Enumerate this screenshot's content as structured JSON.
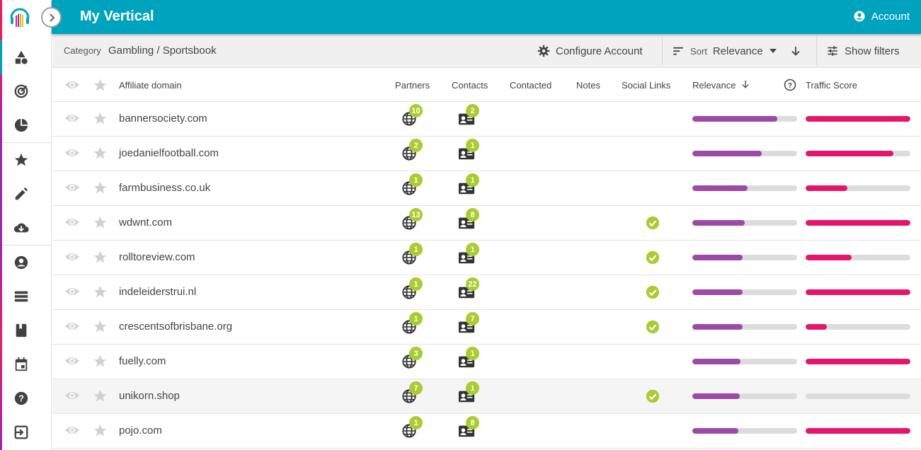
{
  "header": {
    "title": "My Vertical",
    "account_label": "Account"
  },
  "toolbar": {
    "category_label": "Category",
    "category_value": "Gambling / Sportsbook",
    "configure_label": "Configure Account",
    "sort_label": "Sort",
    "sort_value": "Relevance",
    "filters_label": "Show filters"
  },
  "table": {
    "headers": {
      "domain": "Affiliate domain",
      "partners": "Partners",
      "contacts": "Contacts",
      "contacted": "Contacted",
      "notes": "Notes",
      "social": "Social Links",
      "relevance": "Relevance",
      "traffic": "Traffic Score"
    },
    "rows": [
      {
        "domain": "bannersociety.com",
        "partners": "10",
        "contacts": "2",
        "social": false,
        "relevance": 0.81,
        "traffic": 1.0
      },
      {
        "domain": "joedanielfootball.com",
        "partners": "2",
        "contacts": "1",
        "social": false,
        "relevance": 0.66,
        "traffic": 0.84
      },
      {
        "domain": "farmbusiness.co.uk",
        "partners": "1",
        "contacts": "1",
        "social": false,
        "relevance": 0.53,
        "traffic": 0.4
      },
      {
        "domain": "wdwnt.com",
        "partners": "13",
        "contacts": "8",
        "social": true,
        "relevance": 0.5,
        "traffic": 1.0
      },
      {
        "domain": "rolltoreview.com",
        "partners": "1",
        "contacts": "1",
        "social": true,
        "relevance": 0.48,
        "traffic": 0.44
      },
      {
        "domain": "indeleiderstrui.nl",
        "partners": "1",
        "contacts": "22",
        "social": true,
        "relevance": 0.48,
        "traffic": 1.0
      },
      {
        "domain": "crescentsofbrisbane.org",
        "partners": "1",
        "contacts": "7",
        "social": true,
        "relevance": 0.48,
        "traffic": 0.2
      },
      {
        "domain": "fuelly.com",
        "partners": "3",
        "contacts": "1",
        "social": false,
        "relevance": 0.46,
        "traffic": 1.0
      },
      {
        "domain": "unikorn.shop",
        "partners": "7",
        "contacts": "1",
        "social": true,
        "relevance": 0.45,
        "traffic": 0.0
      },
      {
        "domain": "pojo.com",
        "partners": "1",
        "contacts": "8",
        "social": false,
        "relevance": 0.44,
        "traffic": 1.0
      }
    ]
  },
  "colors": {
    "accent": "#00a3bd",
    "badge": "#a8cc32",
    "relevance": "#9c4aa6",
    "traffic": "#e5166a"
  }
}
